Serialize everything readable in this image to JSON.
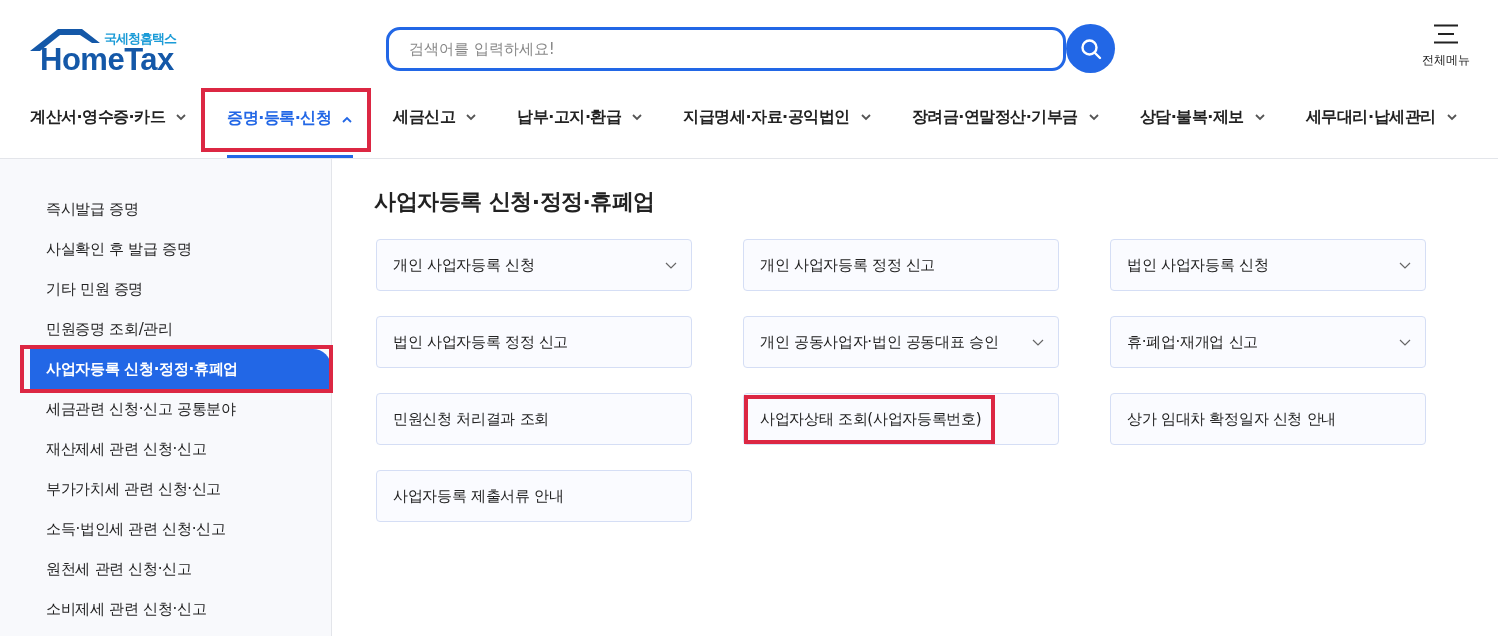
{
  "logo": {
    "subtitle": "국세청홈택스",
    "title": "HomeTax"
  },
  "search": {
    "placeholder": "검색어를 입력하세요!"
  },
  "all_menu": {
    "label": "전체메뉴"
  },
  "nav": [
    {
      "label": "계산서·영수증·카드",
      "selected": false,
      "highlighted": false
    },
    {
      "label": "증명·등록·신청",
      "selected": true,
      "highlighted": true
    },
    {
      "label": "세금신고",
      "selected": false,
      "highlighted": false
    },
    {
      "label": "납부·고지·환급",
      "selected": false,
      "highlighted": false
    },
    {
      "label": "지급명세·자료·공익법인",
      "selected": false,
      "highlighted": false
    },
    {
      "label": "장려금·연말정산·기부금",
      "selected": false,
      "highlighted": false
    },
    {
      "label": "상담·불복·제보",
      "selected": false,
      "highlighted": false
    },
    {
      "label": "세무대리·납세관리",
      "selected": false,
      "highlighted": false
    }
  ],
  "sidebar": {
    "items": [
      {
        "label": "즉시발급 증명",
        "selected": false,
        "highlighted": false
      },
      {
        "label": "사실확인 후 발급 증명",
        "selected": false,
        "highlighted": false
      },
      {
        "label": "기타 민원 증명",
        "selected": false,
        "highlighted": false
      },
      {
        "label": "민원증명 조회/관리",
        "selected": false,
        "highlighted": false
      },
      {
        "label": "사업자등록 신청·정정·휴폐업",
        "selected": true,
        "highlighted": true
      },
      {
        "label": "세금관련 신청·신고 공통분야",
        "selected": false,
        "highlighted": false
      },
      {
        "label": "재산제세 관련 신청·신고",
        "selected": false,
        "highlighted": false
      },
      {
        "label": "부가가치세 관련 신청·신고",
        "selected": false,
        "highlighted": false
      },
      {
        "label": "소득·법인세 관련 신청·신고",
        "selected": false,
        "highlighted": false
      },
      {
        "label": "원천세 관련 신청·신고",
        "selected": false,
        "highlighted": false
      },
      {
        "label": "소비제세 관련 신청·신고",
        "selected": false,
        "highlighted": false
      }
    ]
  },
  "content": {
    "title": "사업자등록 신청·정정·휴폐업",
    "cards": [
      {
        "label": "개인 사업자등록 신청",
        "expandable": true,
        "highlighted": false
      },
      {
        "label": "개인 사업자등록 정정 신고",
        "expandable": false,
        "highlighted": false
      },
      {
        "label": "법인 사업자등록 신청",
        "expandable": true,
        "highlighted": false
      },
      {
        "label": "법인 사업자등록 정정 신고",
        "expandable": false,
        "highlighted": false
      },
      {
        "label": "개인 공동사업자·법인 공동대표 승인",
        "expandable": true,
        "highlighted": false
      },
      {
        "label": "휴·폐업·재개업 신고",
        "expandable": true,
        "highlighted": false
      },
      {
        "label": "민원신청 처리결과 조회",
        "expandable": false,
        "highlighted": false
      },
      {
        "label": "사업자상태 조회(사업자등록번호)",
        "expandable": false,
        "highlighted": true
      },
      {
        "label": "상가 임대차 확정일자 신청 안내",
        "expandable": false,
        "highlighted": false
      },
      {
        "label": "사업자등록 제출서류 안내",
        "expandable": false,
        "highlighted": false
      }
    ]
  }
}
